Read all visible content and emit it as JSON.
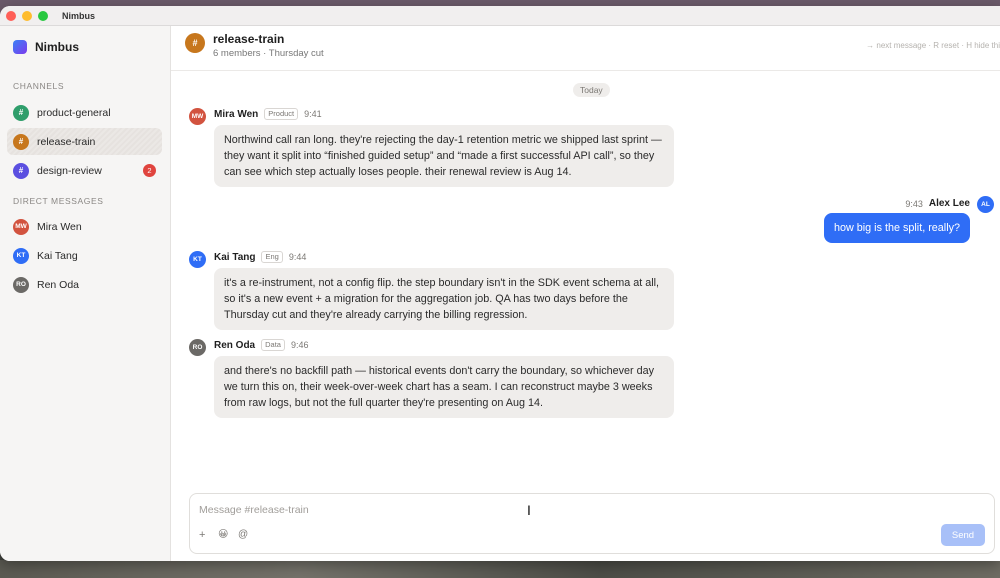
{
  "window": {
    "app_title": "Nimbus"
  },
  "sidebar": {
    "brand": "Nimbus",
    "channels_label": "CHANNELS",
    "channels": [
      {
        "name": "product-general",
        "icon": "#",
        "color": "#2f9e6b",
        "active": false,
        "badge": ""
      },
      {
        "name": "release-train",
        "icon": "#",
        "color": "#c7771d",
        "active": true,
        "badge": ""
      },
      {
        "name": "design-review",
        "icon": "#",
        "color": "#5b4fe0",
        "active": false,
        "badge": "2"
      }
    ],
    "dm_label": "DIRECT MESSAGES",
    "dms": [
      {
        "name": "Mira Wen",
        "initials": "MW",
        "color": "#d2533f"
      },
      {
        "name": "Kai Tang",
        "initials": "KT",
        "color": "#2f6df6"
      },
      {
        "name": "Ren Oda",
        "initials": "RO",
        "color": "#6b6966"
      }
    ]
  },
  "header": {
    "icon": "#",
    "title": "release-train",
    "subtitle": "6 members · Thursday cut",
    "hints": "→ next message · R reset · H hide thi"
  },
  "today_label": "Today",
  "messages": [
    {
      "author": "Mira Wen",
      "initials": "MW",
      "color": "#d2533f",
      "role": "Product",
      "time": "9:41",
      "text": "Northwind call ran long. they're rejecting the day-1 retention metric we shipped last sprint — they want it split into “finished guided setup” and “made a first successful API call”, so they can see which step actually loses people. their renewal review is Aug 14."
    },
    {
      "author": "Kai Tang",
      "initials": "KT",
      "color": "#2f6df6",
      "role": "Eng",
      "time": "9:44",
      "text": "it's a re-instrument, not a config flip. the step boundary isn't in the SDK event schema at all, so it's a new event + a migration for the aggregation job. QA has two days before the Thursday cut and they're already carrying the billing regression."
    },
    {
      "author": "Ren Oda",
      "initials": "RO",
      "color": "#6b6966",
      "role": "Data",
      "time": "9:46",
      "text": "and there's no backfill path — historical events don't carry the boundary, so whichever day we turn this on, their week-over-week chart has a seam. I can reconstruct maybe 3 weeks from raw logs, but not the full quarter they're presenting on Aug 14."
    }
  ],
  "outgoing": {
    "author": "Alex Lee",
    "initials": "AL",
    "color": "#2f6df6",
    "time": "9:43",
    "text": "how big is the split, really?"
  },
  "composer": {
    "placeholder": "Message #release-train",
    "plus": "+",
    "emoji": "😀",
    "mention": "@",
    "send_label": "Send"
  },
  "colors": {
    "accent": "#2f6df6",
    "send_disabled": "#a8c0f8",
    "badge": "#e0443e"
  }
}
